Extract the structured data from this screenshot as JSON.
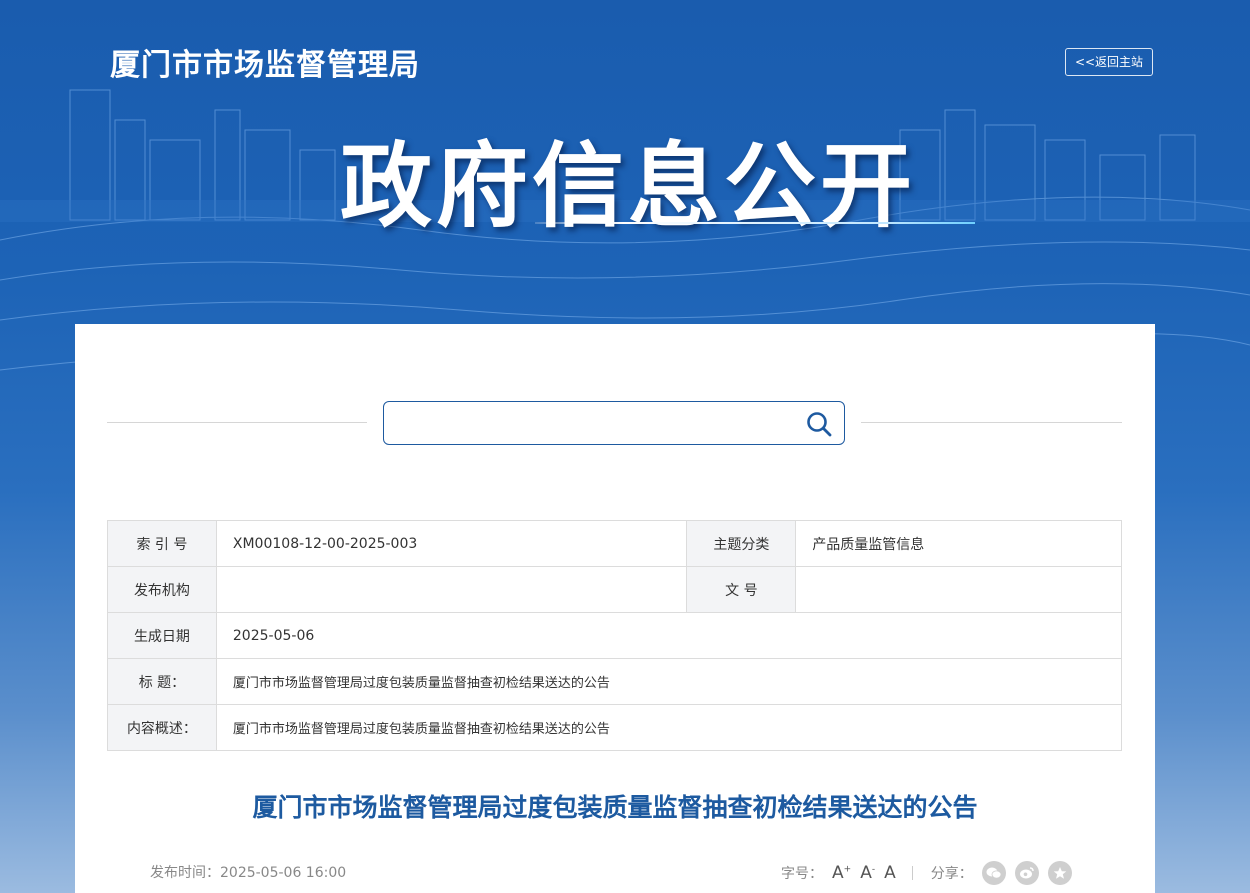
{
  "header": {
    "site_title": "厦门市市场监督管理局",
    "back_label": "<<返回主站",
    "hero_title": "政府信息公开"
  },
  "search": {
    "value": "",
    "placeholder": ""
  },
  "meta": {
    "index_label": "索 引 号",
    "index_value": "XM00108-12-00-2025-003",
    "topic_label": "主题分类",
    "topic_value": "产品质量监管信息",
    "issuer_label": "发布机构",
    "issuer_value": "",
    "docno_label": "文 号",
    "docno_value": "",
    "date_label": "生成日期",
    "date_value": "2025-05-06",
    "title_label": "标 题：",
    "title_value": "厦门市市场监督管理局过度包装质量监督抽查初检结果送达的公告",
    "summary_label": "内容概述：",
    "summary_value": "厦门市市场监督管理局过度包装质量监督抽查初检结果送达的公告"
  },
  "article": {
    "title": "厦门市市场监督管理局过度包装质量监督抽查初检结果送达的公告",
    "publish_time": "发布时间：2025-05-06 16:00"
  },
  "tools": {
    "font_label": "字号：",
    "font_large": "A",
    "font_large_mark": "+",
    "font_small": "A",
    "font_small_mark": "-",
    "font_default": "A",
    "share_label": "分享："
  },
  "icons": [
    "search-icon",
    "wechat-icon",
    "weibo-icon",
    "star-icon"
  ],
  "colors": {
    "banner": "#1a5cae",
    "accent": "#1d5aa0",
    "label_bg": "#f3f4f6"
  }
}
